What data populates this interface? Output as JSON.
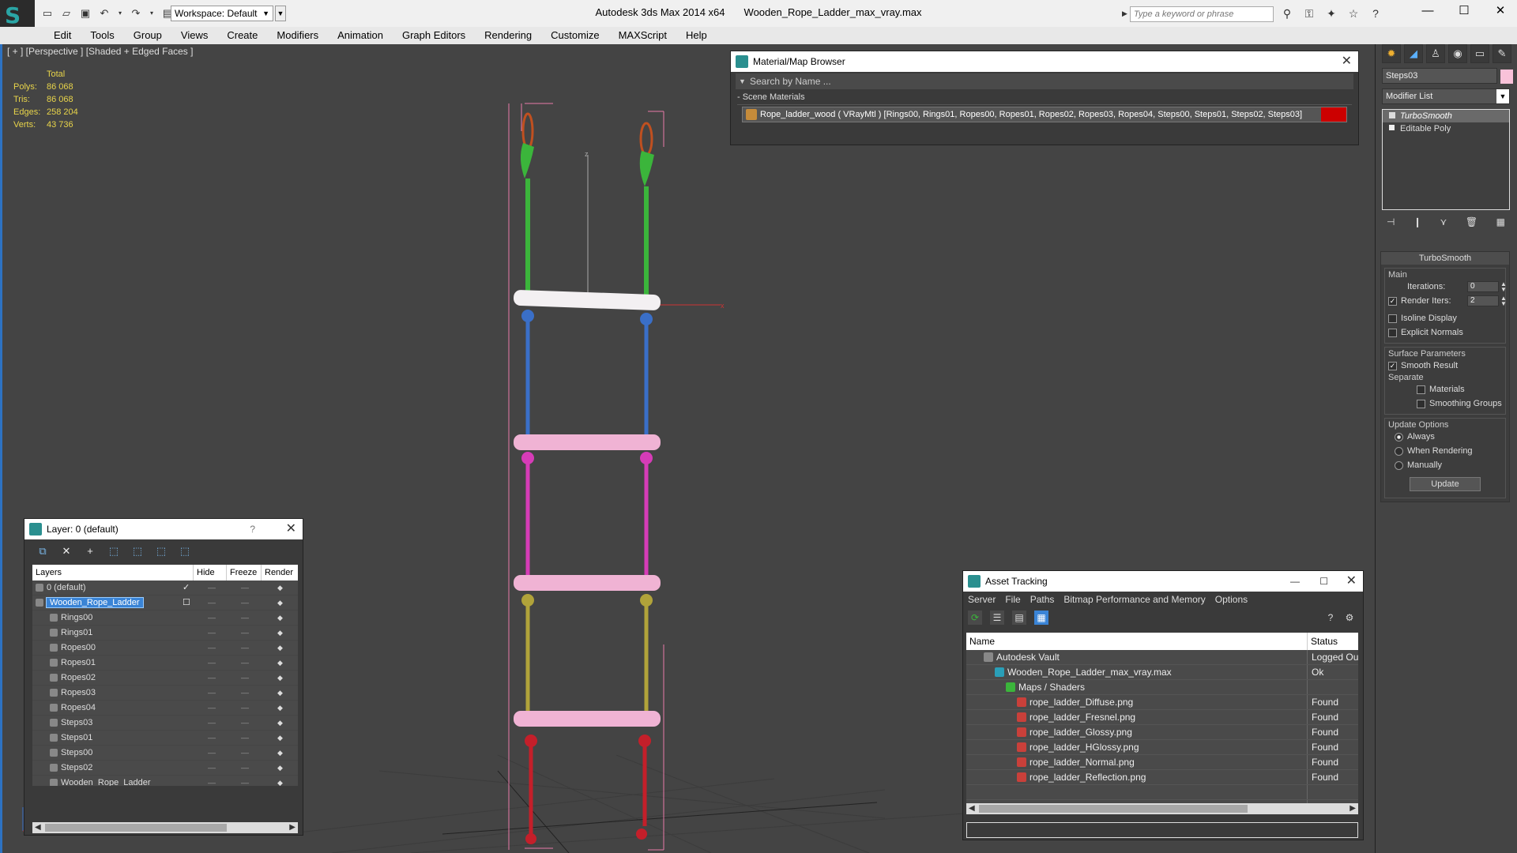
{
  "app": {
    "title": "Autodesk 3ds Max  2014 x64",
    "file": "Wooden_Rope_Ladder_max_vray.max",
    "workspace_label": "Workspace: Default",
    "search_placeholder": "Type a keyword or phrase"
  },
  "menu": [
    "Edit",
    "Tools",
    "Group",
    "Views",
    "Create",
    "Modifiers",
    "Animation",
    "Graph Editors",
    "Rendering",
    "Customize",
    "MAXScript",
    "Help"
  ],
  "viewport": {
    "label": "[ + ] [Perspective ] [Shaded + Edged Faces ]",
    "stats": {
      "header": "Total",
      "rows": [
        {
          "k": "Polys:",
          "v": "86 068"
        },
        {
          "k": "Tris:",
          "v": "86 068"
        },
        {
          "k": "Edges:",
          "v": "258 204"
        },
        {
          "k": "Verts:",
          "v": "43 736"
        }
      ]
    },
    "axis_x": "x",
    "axis_z": "z"
  },
  "material_browser": {
    "title": "Material/Map Browser",
    "search_placeholder": "Search by Name ...",
    "section": "- Scene Materials",
    "material": "Rope_ladder_wood  ( VRayMtl )  [Rings00, Rings01, Ropes00, Ropes01, Ropes02, Ropes03, Ropes04, Steps00, Steps01, Steps02, Steps03]",
    "swatch_color": "#cc0000"
  },
  "command_panel": {
    "object_name": "Steps03",
    "object_color": "#f9c2d9",
    "modifier_list": "Modifier List",
    "stack": [
      "TurboSmooth",
      "Editable Poly"
    ],
    "rollout": {
      "title": "TurboSmooth",
      "main_group": "Main",
      "iterations_label": "Iterations:",
      "iterations_value": "0",
      "render_iters_label": "Render Iters:",
      "render_iters_value": "2",
      "isoline": "Isoline Display",
      "explicit": "Explicit Normals",
      "surface_group": "Surface Parameters",
      "smooth_result": "Smooth Result",
      "separate": "Separate",
      "materials": "Materials",
      "smoothing_groups": "Smoothing Groups",
      "update_group": "Update Options",
      "always": "Always",
      "when_rendering": "When Rendering",
      "manually": "Manually",
      "update_btn": "Update"
    }
  },
  "layer_panel": {
    "title": "Layer: 0 (default)",
    "help": "?",
    "columns": [
      "Layers",
      "Hide",
      "Freeze",
      "Render"
    ],
    "rows": [
      {
        "name": "0 (default)",
        "indent": 0,
        "mark": "✓"
      },
      {
        "name": "Wooden_Rope_Ladder",
        "indent": 0,
        "mark": "☐",
        "selected": true
      },
      {
        "name": "Rings00",
        "indent": 1
      },
      {
        "name": "Rings01",
        "indent": 1
      },
      {
        "name": "Ropes00",
        "indent": 1
      },
      {
        "name": "Ropes01",
        "indent": 1
      },
      {
        "name": "Ropes02",
        "indent": 1
      },
      {
        "name": "Ropes03",
        "indent": 1
      },
      {
        "name": "Ropes04",
        "indent": 1
      },
      {
        "name": "Steps03",
        "indent": 1
      },
      {
        "name": "Steps01",
        "indent": 1
      },
      {
        "name": "Steps00",
        "indent": 1
      },
      {
        "name": "Steps02",
        "indent": 1
      },
      {
        "name": "Wooden_Rope_Ladder",
        "indent": 1
      }
    ]
  },
  "asset_tracking": {
    "title": "Asset Tracking",
    "menu": [
      "Server",
      "File",
      "Paths",
      "Bitmap Performance and Memory",
      "Options"
    ],
    "columns": [
      "Name",
      "Status"
    ],
    "rows": [
      {
        "name": "Autodesk Vault",
        "status": "Logged Out",
        "indent": 1,
        "icon": "vault"
      },
      {
        "name": "Wooden_Rope_Ladder_max_vray.max",
        "status": "Ok",
        "indent": 2,
        "icon": "max"
      },
      {
        "name": "Maps / Shaders",
        "status": "",
        "indent": 3,
        "icon": "maps"
      },
      {
        "name": "rope_ladder_Diffuse.png",
        "status": "Found",
        "indent": 4,
        "icon": "png"
      },
      {
        "name": "rope_ladder_Fresnel.png",
        "status": "Found",
        "indent": 4,
        "icon": "png"
      },
      {
        "name": "rope_ladder_Glossy.png",
        "status": "Found",
        "indent": 4,
        "icon": "png"
      },
      {
        "name": "rope_ladder_HGlossy.png",
        "status": "Found",
        "indent": 4,
        "icon": "png"
      },
      {
        "name": "rope_ladder_Normal.png",
        "status": "Found",
        "indent": 4,
        "icon": "png"
      },
      {
        "name": "rope_ladder_Reflection.png",
        "status": "Found",
        "indent": 4,
        "icon": "png"
      }
    ]
  }
}
